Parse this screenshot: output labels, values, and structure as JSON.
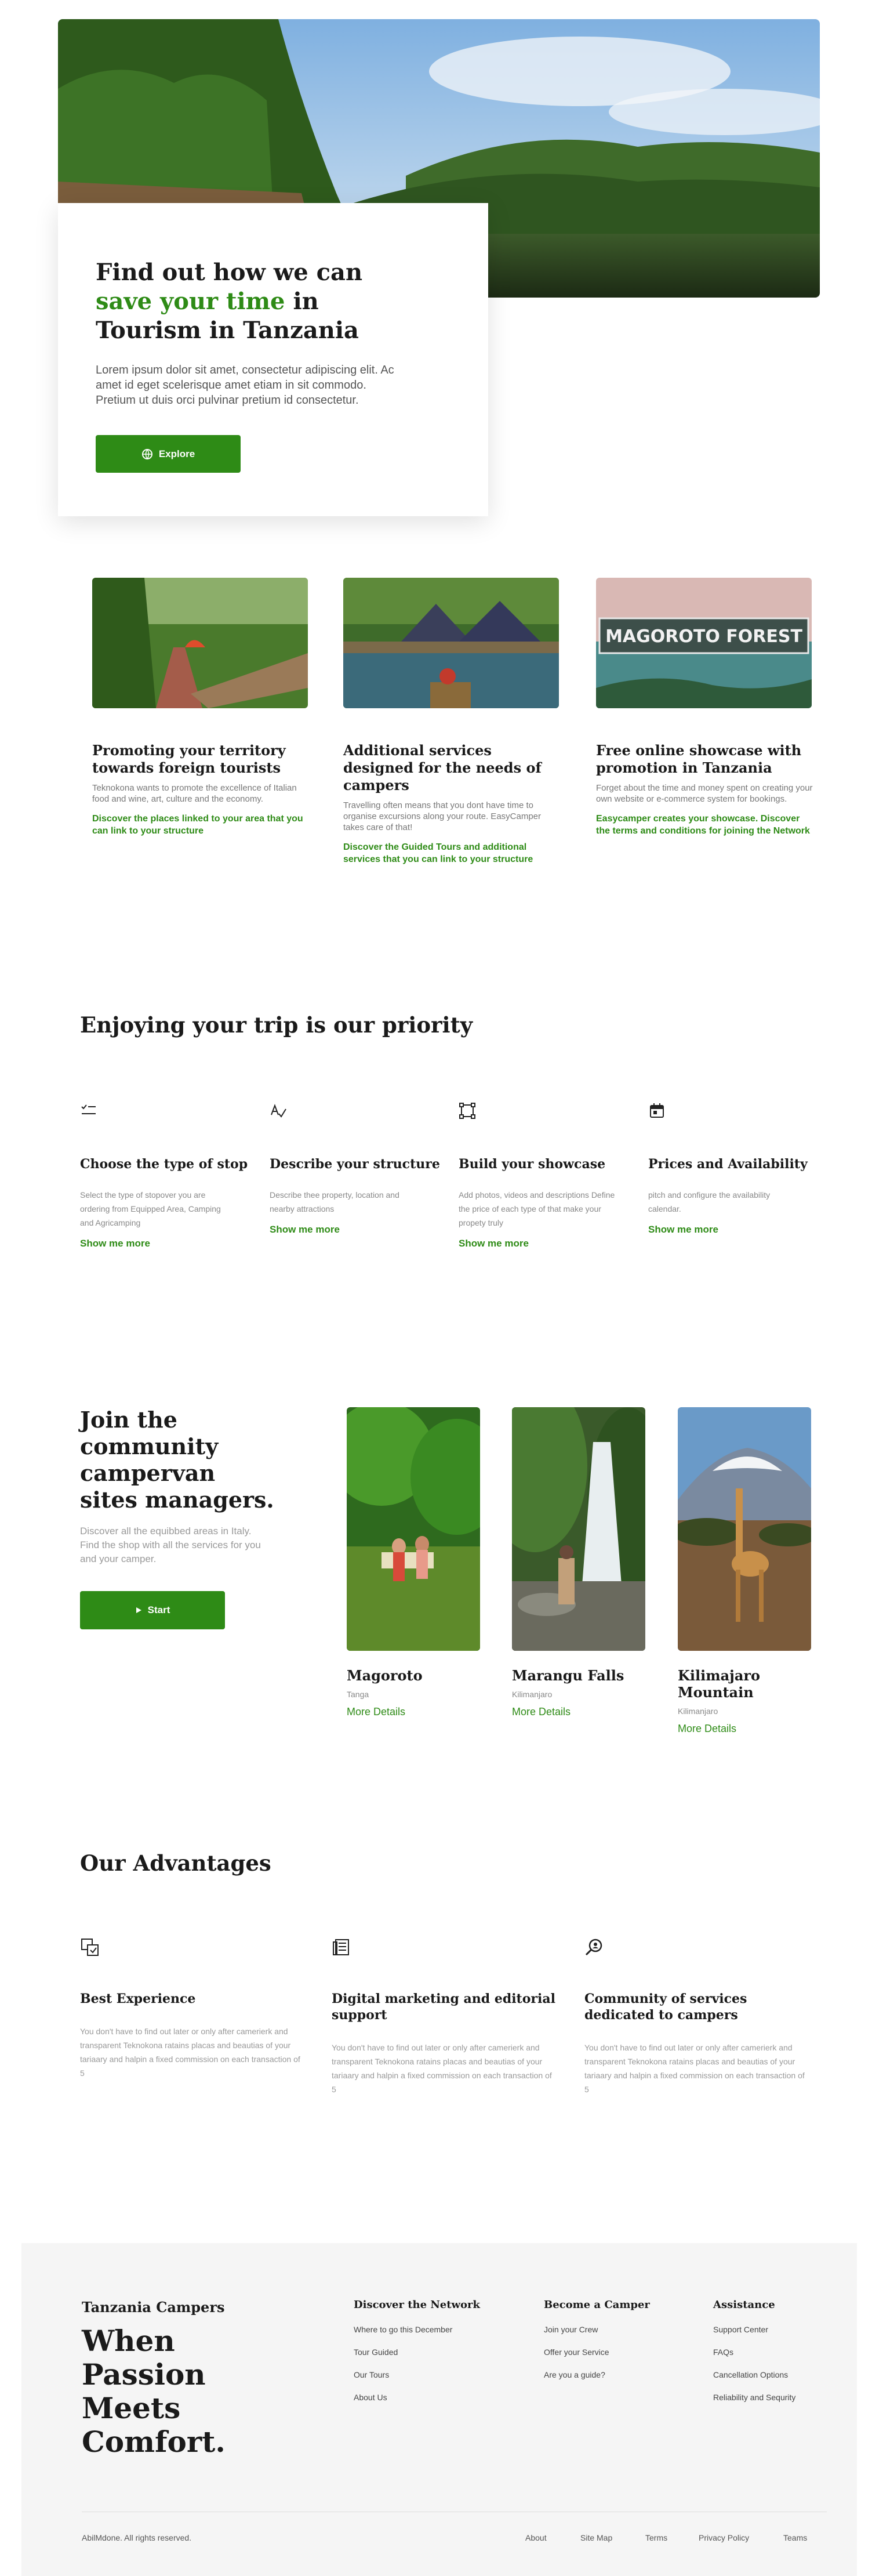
{
  "hero": {
    "title_part1": "Find out how we can ",
    "title_highlight": "save your time",
    "title_part2": " in Tourism in Tanzania",
    "description": "Lorem ipsum dolor sit amet, consectetur adipiscing elit. Ac amet id eget scelerisque amet etiam in sit commodo. Pretium ut duis orci pulvinar pretium id consectetur.",
    "button_label": "Explore",
    "button_icon": "globe-icon"
  },
  "features": [
    {
      "title": "Promoting your territory towards foreign tourists",
      "description": "Teknokona  wants to promote the excellence of Italian food and wine, art, culture and the economy.",
      "link": "Discover the places linked to your area that you can link to your structure"
    },
    {
      "title": "Additional services designed for the needs of campers",
      "description": "Travelling often means that you dont have time to organise excursions along your route. EasyCamper takes care of that!",
      "link": "Discover the Guided Tours and additional services that you can link to your structure"
    },
    {
      "title": "Free online showcase with promotion in Tanzania",
      "description": "Forget about the time and money spent on creating your own website or e-commerce system for bookings.",
      "link": "Easycamper creates your showcase. Discover the terms and conditions for joining the Network",
      "image_text": "MAGOROTO FOREST"
    }
  ],
  "priority": {
    "title": "Enjoying your trip is our priority",
    "steps": [
      {
        "icon": "list-check-icon",
        "title": "Choose the type of stop",
        "description": "Select the type of stopover you are ordering from Equipped Area, Camping and Agricamping",
        "more": "Show me more"
      },
      {
        "icon": "spell-check-icon",
        "title": "Describe your structure",
        "description": "Describe thee property, location and nearby attractions",
        "more": "Show me more"
      },
      {
        "icon": "vector-square-icon",
        "title": "Build your showcase",
        "description": "Add photos, videos and descriptions Define the price of each type of that make your propety truly",
        "more": "Show me more"
      },
      {
        "icon": "calendar-icon",
        "title": "Prices and Availability",
        "description": "pitch and configure the availability calendar.",
        "more": "Show me more"
      }
    ]
  },
  "community": {
    "title": "Join the community campervan sites managers.",
    "description": "Discover all the equibbed areas in Italy. Find the shop with all the services for you and your camper.",
    "button_label": "Start",
    "places": [
      {
        "name": "Magoroto",
        "region": "Tanga",
        "more": "More Details"
      },
      {
        "name": "Marangu Falls",
        "region": "Kilimanjaro",
        "more": "More Details"
      },
      {
        "name": "Kilimajaro Mountain",
        "region": "Kilimanjaro",
        "more": "More Details"
      }
    ]
  },
  "advantages": {
    "title": "Our Advantages",
    "items": [
      {
        "icon": "experience-icon",
        "title": "Best Experience",
        "description": "You don't have to find out later or only after camerierk and transparent Teknokona ratains placas and beautias of your tariaary and halpin a fixed commission on each transaction of 5"
      },
      {
        "icon": "newspaper-icon",
        "title": "Digital marketing and editorial support",
        "description": "You don't have to find out later or only after camerierk and transparent Teknokona ratains placas and beautias of your tariaary and halpin a fixed commission on each transaction of 5"
      },
      {
        "icon": "search-community-icon",
        "title": "Community of services dedicated to campers",
        "description": "You don't have to find out later or only after camerierk and transparent Teknokona ratains placas and beautias of your tariaary and halpin a fixed commission on each transaction of 5"
      }
    ]
  },
  "footer": {
    "brand": "Tanzania Campers",
    "slogan": "When Passion Meets Comfort.",
    "columns": [
      {
        "title": "Discover the Network",
        "links": [
          "Where to go this December",
          "Tour Guided",
          "Our Tours",
          "About Us"
        ]
      },
      {
        "title": "Become a Camper",
        "links": [
          "Join your Crew",
          "Offer your Service",
          "Are you a guide?"
        ]
      },
      {
        "title": "Assistance",
        "links": [
          "Support Center",
          "FAQs",
          "Cancellation Options",
          "Reliability and Sequrity"
        ]
      }
    ],
    "copyright": "AbilMdone. All rights reserved.",
    "legal": [
      "About",
      "Site Map",
      "Terms",
      "Privacy Policy",
      "Teams"
    ]
  },
  "colors": {
    "accent": "#2e8b16",
    "footer_bg": "#f5f5f5"
  }
}
